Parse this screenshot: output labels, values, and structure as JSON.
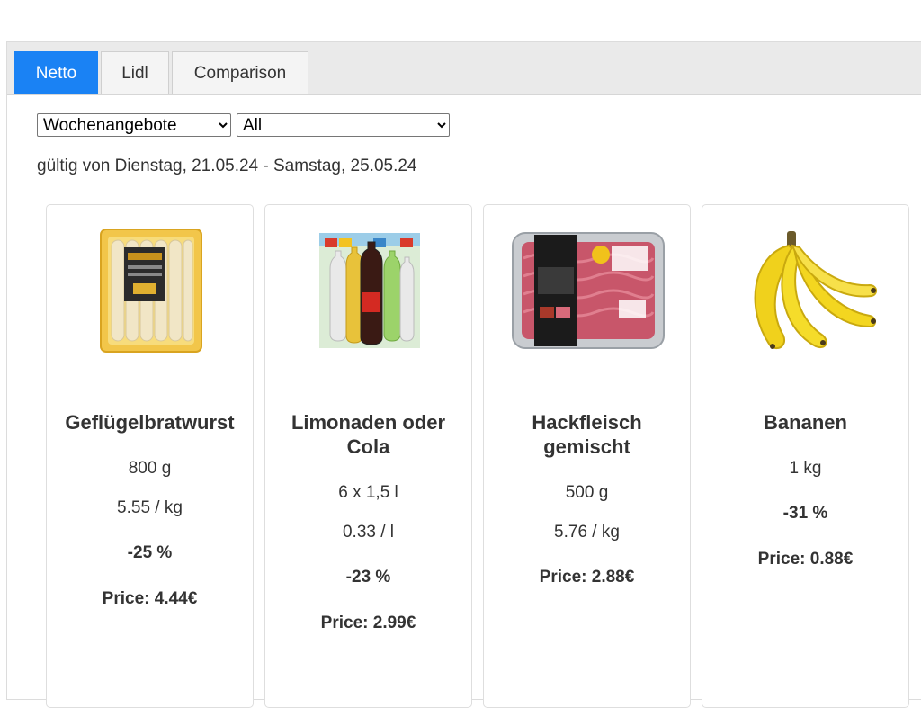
{
  "tabs": [
    {
      "label": "Netto",
      "active": true
    },
    {
      "label": "Lidl",
      "active": false
    },
    {
      "label": "Comparison",
      "active": false
    }
  ],
  "filters": {
    "category": {
      "selected": "Wochenangebote"
    },
    "subcategory": {
      "selected": "All"
    }
  },
  "validity": "gültig von Dienstag, 21.05.24 - Samstag, 25.05.24",
  "colors": {
    "accent": "#1a82f4",
    "text": "#333333",
    "border": "#dedede"
  },
  "products": [
    {
      "name": "Geflügelbratwurst",
      "amount": "800 g",
      "unit_price": "5.55 / kg",
      "discount": "-25 %",
      "price": "Price: 4.44€",
      "image_icon": "sausage-pack-icon"
    },
    {
      "name": "Limonaden oder Cola",
      "amount": "6 x 1,5 l",
      "unit_price": "0.33 / l",
      "discount": "-23 %",
      "price": "Price: 2.99€",
      "image_icon": "soda-bottles-icon"
    },
    {
      "name": "Hackfleisch gemischt",
      "amount": "500 g",
      "unit_price": "5.76 / kg",
      "discount": "",
      "price": "Price: 2.88€",
      "image_icon": "minced-meat-tray-icon"
    },
    {
      "name": "Bananen",
      "amount": "1 kg",
      "unit_price": "",
      "discount": "-31 %",
      "price": "Price: 0.88€",
      "image_icon": "bananas-icon"
    }
  ]
}
